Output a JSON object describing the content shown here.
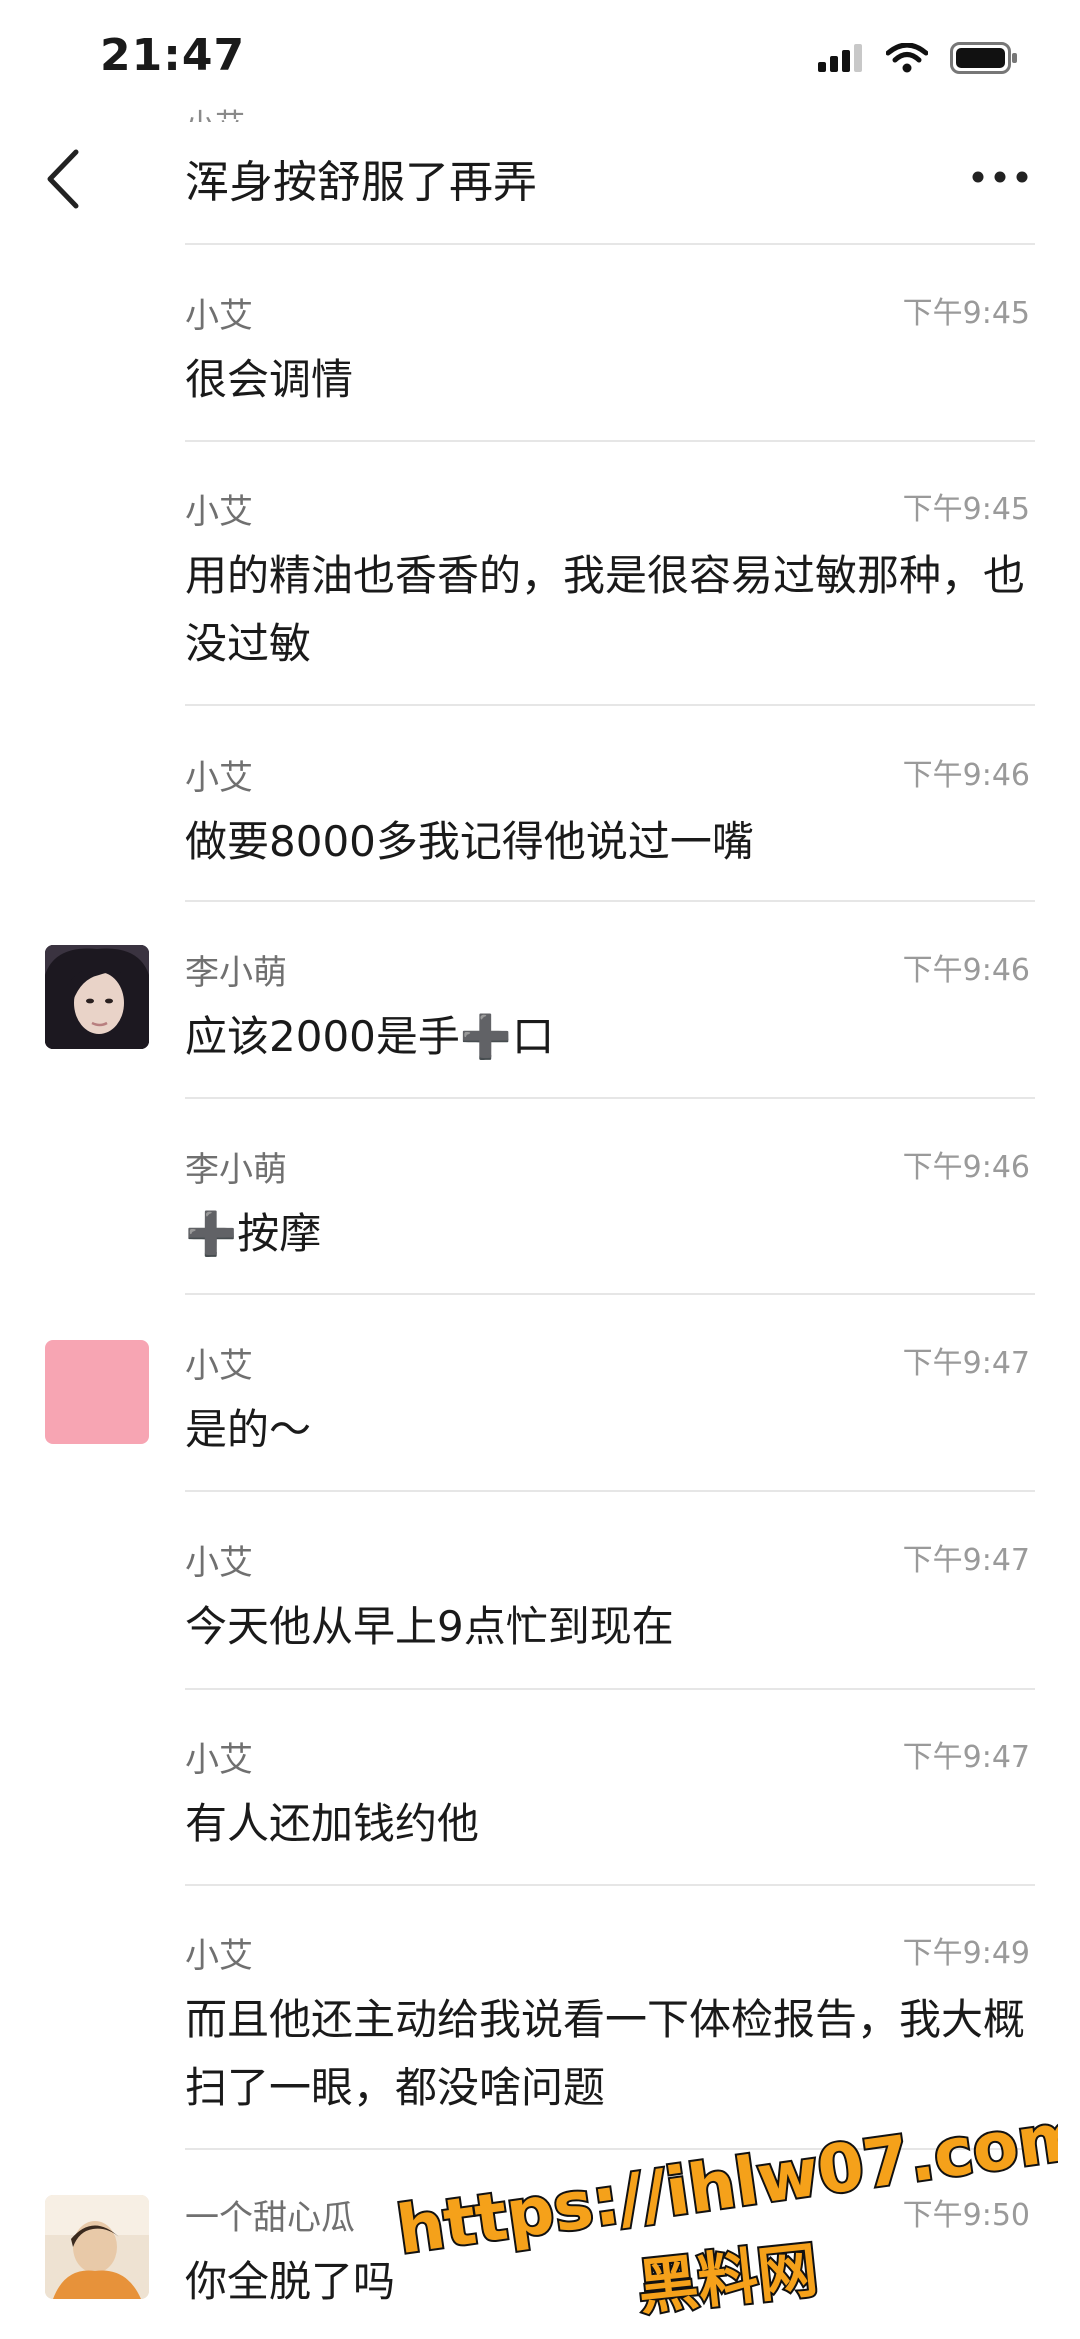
{
  "status_bar": {
    "time": "21:47"
  },
  "header": {
    "peek_text": "小艾",
    "title": "浑身按舒服了再弄"
  },
  "messages": [
    {
      "sender": "小艾",
      "time": "下午9:45",
      "text": "很会调情"
    },
    {
      "sender": "小艾",
      "time": "下午9:45",
      "text": "用的精油也香香的，我是很容易过敏那种，也没过敏"
    },
    {
      "sender": "小艾",
      "time": "下午9:46",
      "text": "做要8000多我记得他说过一嘴"
    },
    {
      "sender": "李小萌",
      "time": "下午9:46",
      "text": "应该2000是手➕口"
    },
    {
      "sender": "李小萌",
      "time": "下午9:46",
      "text": "➕按摩"
    },
    {
      "sender": "小艾",
      "time": "下午9:47",
      "text": "是的～"
    },
    {
      "sender": "小艾",
      "time": "下午9:47",
      "text": "今天他从早上9点忙到现在"
    },
    {
      "sender": "小艾",
      "time": "下午9:47",
      "text": "有人还加钱约他"
    },
    {
      "sender": "小艾",
      "time": "下午9:49",
      "text": "而且他还主动给我说看一下体检报告，我大概扫了一眼，都没啥问题"
    },
    {
      "sender": "一个甜心瓜",
      "time": "下午9:50",
      "text": "你全脱了吗"
    }
  ],
  "watermark": {
    "line1": "https://ihlw07.com",
    "line2": "黑料网"
  },
  "colors": {
    "accent_pink": "#f7a5b3",
    "watermark_fill": "#f5a11a"
  }
}
